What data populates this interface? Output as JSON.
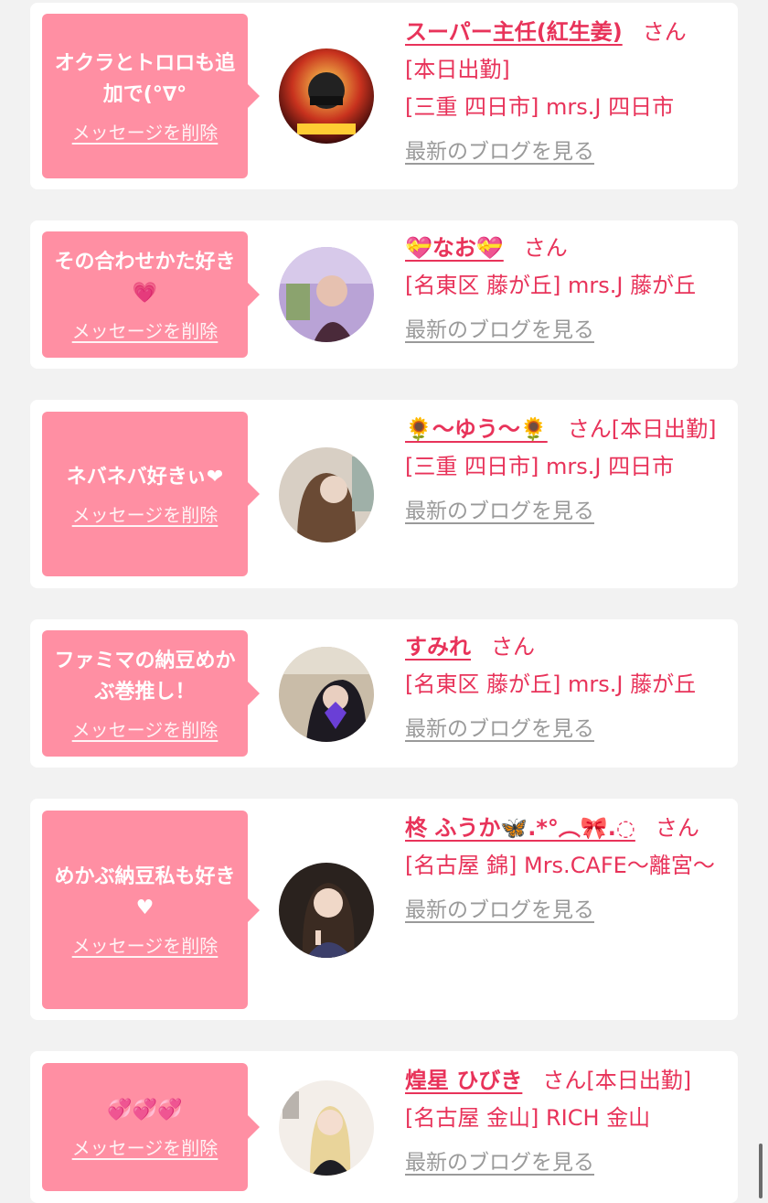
{
  "colors": {
    "background": "#f2f2f2",
    "card": "#ffffff",
    "bubble": "#ff8fa3",
    "accent": "#e8335a",
    "muted_link": "#9a9a9a"
  },
  "delete_label": "メッセージを削除",
  "blog_label": "最新のブログを見る",
  "san_label": "さん",
  "messages": [
    {
      "message": "オクラとトロロも追加で(°∇°",
      "name": "スーパー主任(紅生姜)",
      "status": "[本日出勤]",
      "store": "[三重 四日市] mrs.J 四日市",
      "avatar_icon": "profile-photo"
    },
    {
      "message": "その合わせかた好き💗",
      "name": "💝なお💝",
      "status": "",
      "store": "[名東区 藤が丘] mrs.J 藤が丘",
      "avatar_icon": "profile-photo"
    },
    {
      "message": "ネバネバ好きぃ❤",
      "name": "🌻〜ゆう〜🌻",
      "status": "[本日出勤]",
      "store": "[三重 四日市] mrs.J 四日市",
      "avatar_icon": "profile-photo"
    },
    {
      "message": "ファミマの納豆めかぶ巻推し！",
      "name": "すみれ",
      "status": "",
      "store": "[名東区 藤が丘] mrs.J 藤が丘",
      "avatar_icon": "profile-photo"
    },
    {
      "message": "めかぶ納豆私も好き♥",
      "name": "柊 ふうか🦋.*°︵🎀.◌",
      "status": "",
      "store": "[名古屋 錦] Mrs.CAFE〜離宮〜",
      "avatar_icon": "profile-photo"
    },
    {
      "message": "💞💞💞",
      "name": "煌星 ひびき",
      "status": "[本日出勤]",
      "store": "[名古屋 金山] RICH 金山",
      "avatar_icon": "profile-photo"
    }
  ]
}
